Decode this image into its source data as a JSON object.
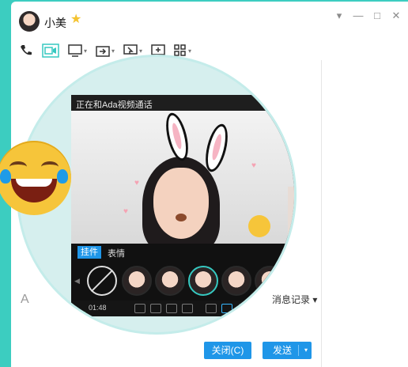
{
  "contact": {
    "name": "小美",
    "star": "★"
  },
  "window_controls": {
    "settings": "▾",
    "minimize": "—",
    "maximize": "□",
    "close": "✕"
  },
  "toolbar": {
    "icons": [
      "phone-icon",
      "video-call-icon",
      "screen-share-icon",
      "file-transfer-icon",
      "remote-desktop-icon",
      "group-call-icon",
      "apps-icon"
    ]
  },
  "video_panel": {
    "title": "正在和Ada视频通话",
    "tabs": {
      "active": "挂件",
      "other": "表情"
    },
    "call_time": "01:48"
  },
  "input": {
    "font_icon": "A"
  },
  "history_label": "消息记录 ▾",
  "buttons": {
    "close": "关闭(C)",
    "send": "发送(S)",
    "send_arrow": "▾"
  },
  "colors": {
    "accent": "#1f96e8",
    "background": "#3ccdc0",
    "selection": "#36c9c1"
  }
}
